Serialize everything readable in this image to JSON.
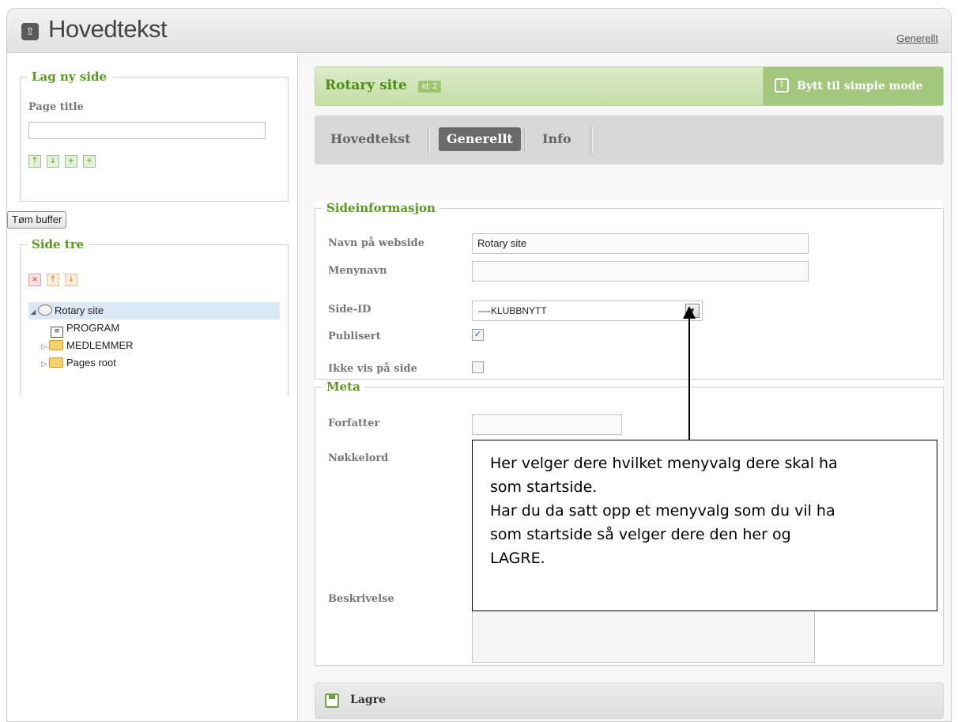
{
  "header": {
    "title": "Hovedtekst",
    "link": "Generellt",
    "home_icon": "home-icon"
  },
  "sidebar": {
    "new_page": {
      "legend": "Lag ny side",
      "field_label": "Page title",
      "input_value": ""
    },
    "clear_buffer": "Tøm buffer",
    "tree_legend": "Side tre",
    "tree": [
      {
        "label": "Rotary site"
      },
      {
        "label": "PROGRAM"
      },
      {
        "label": "MEDLEMMER"
      },
      {
        "label": "Pages root"
      }
    ]
  },
  "site": {
    "name": "Rotary site",
    "id_badge": "id: 2",
    "mode_button": "Bytt til simple mode"
  },
  "tabs": [
    "Hovedtekst",
    "Generellt",
    "Info"
  ],
  "sideinfo": {
    "legend": "Sideinformasjon",
    "fields": {
      "navn_label": "Navn på webside",
      "navn_value": "Rotary site",
      "menynavn_label": "Menynavn",
      "menynavn_value": "",
      "sideid_label": "Side-ID",
      "sideid_value": "----KLUBBNYTT",
      "publisert_label": "Publisert",
      "publisert_checked": true,
      "ikkevis_label": "Ikke vis på side",
      "ikkevis_checked": false
    }
  },
  "meta": {
    "legend": "Meta",
    "forfatter_label": "Forfatter",
    "forfatter_value": "",
    "nokkelord_label": "Nøkkelord",
    "beskrivelse_label": "Beskrivelse"
  },
  "save": {
    "label": "Lagre"
  },
  "callout": {
    "lines": [
      "Her velger dere hvilket menyvalg dere skal ha",
      "som startside.",
      "Har du da satt opp et menyvalg som du vil ha",
      "som startside så velger dere den her og",
      "LAGRE."
    ]
  },
  "colors": {
    "accent_green": "#5a9a1f",
    "tab_active": "#6b6b6b",
    "tree_selected": "#dbe8f6"
  }
}
